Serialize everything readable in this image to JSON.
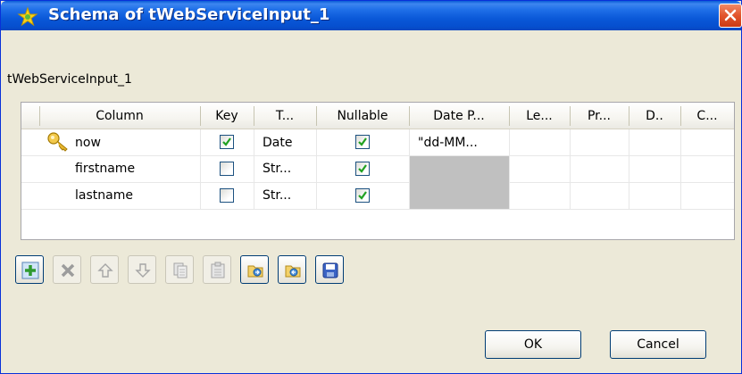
{
  "window": {
    "title": "Schema of tWebServiceInput_1",
    "title_icon": "star-icon",
    "close_icon": "close-icon"
  },
  "schema_label": "tWebServiceInput_1",
  "table": {
    "columns": [
      "Column",
      "Key",
      "T...",
      "Nullable",
      "Date P...",
      "Le...",
      "Pr...",
      "D..",
      "C..."
    ],
    "rows": [
      {
        "column": "now",
        "key": true,
        "type": "Date",
        "nullable": true,
        "date_pattern": "\"dd-MM...",
        "is_key_icon": "key-icon"
      },
      {
        "column": "firstname",
        "key": false,
        "type": "Str...",
        "nullable": true,
        "date_pattern": ""
      },
      {
        "column": "lastname",
        "key": false,
        "type": "Str...",
        "nullable": true,
        "date_pattern": ""
      }
    ]
  },
  "toolbar": {
    "buttons": [
      {
        "name": "add-icon",
        "enabled": true
      },
      {
        "name": "remove-icon",
        "enabled": false
      },
      {
        "name": "move-up-icon",
        "enabled": false
      },
      {
        "name": "move-down-icon",
        "enabled": false
      },
      {
        "name": "copy-icon",
        "enabled": false
      },
      {
        "name": "paste-icon",
        "enabled": false
      },
      {
        "name": "import-icon",
        "enabled": true
      },
      {
        "name": "export-icon",
        "enabled": true
      },
      {
        "name": "save-icon",
        "enabled": true
      }
    ]
  },
  "buttons": {
    "ok": "OK",
    "cancel": "Cancel"
  },
  "colors": {
    "titlebar": "#0a58d8",
    "close": "#e2542c",
    "checkmark": "#21a121",
    "disabled_cell": "#c0c0c0"
  }
}
